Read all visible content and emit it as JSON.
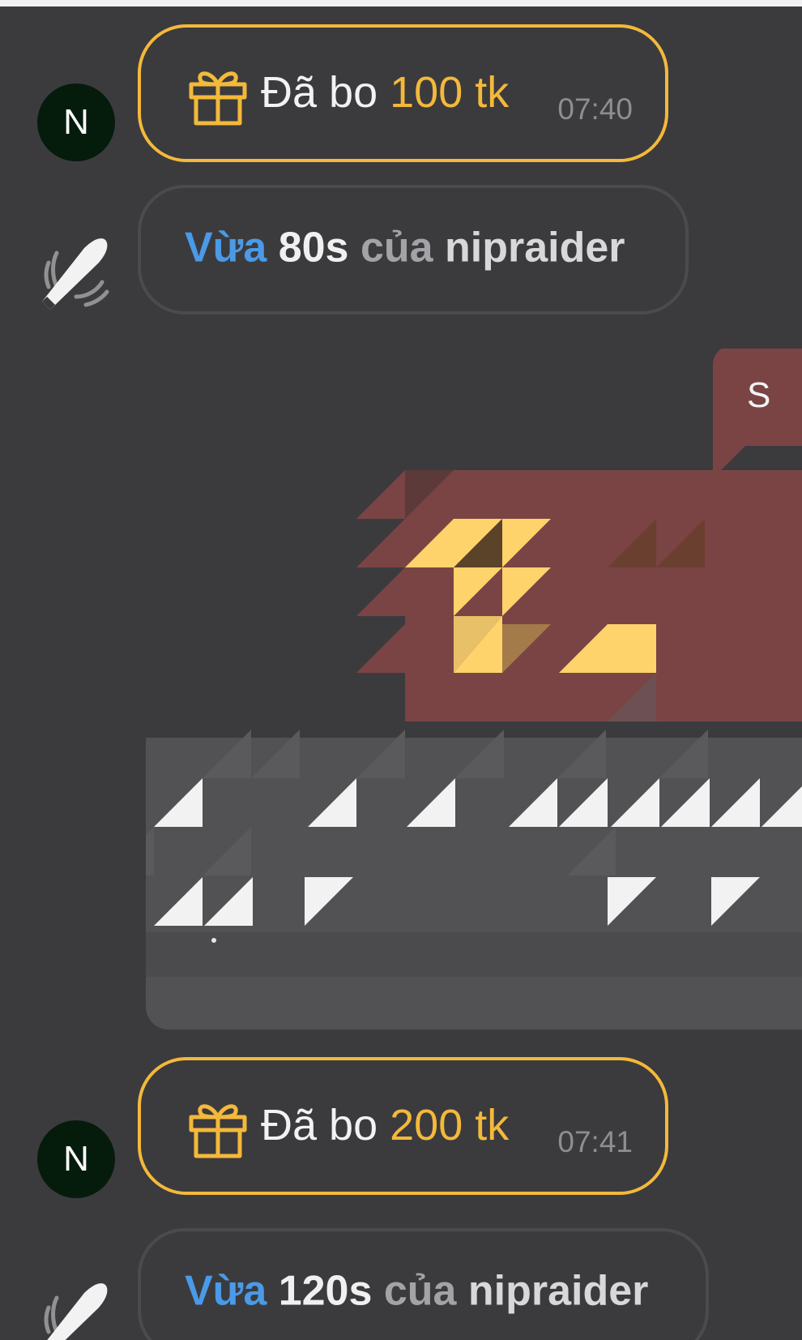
{
  "messages": [
    {
      "type": "gift",
      "avatar_initial": "N",
      "prefix": "Đã bo",
      "amount": "100 tk",
      "time": "07:40"
    },
    {
      "type": "boost",
      "word1": "Vừa",
      "duration": "80s",
      "word2": "của",
      "user": "nipraider"
    },
    {
      "type": "media",
      "corner_letter": "S"
    },
    {
      "type": "gift",
      "avatar_initial": "N",
      "prefix": "Đã bo",
      "amount": "200 tk",
      "time": "07:41"
    },
    {
      "type": "boost",
      "word1": "Vừa",
      "duration": "120s",
      "word2": "của",
      "user": "nipraider"
    }
  ],
  "colors": {
    "background": "#3b3b3e",
    "gift_accent": "#f4b93a",
    "boost_blue": "#4a9ae8",
    "avatar_bg": "#051c0c",
    "media_red": "#7a4445",
    "media_yellow": "#ffd36b"
  },
  "icons": {
    "gift": "gift-icon",
    "boost": "rocket-boost-icon"
  }
}
